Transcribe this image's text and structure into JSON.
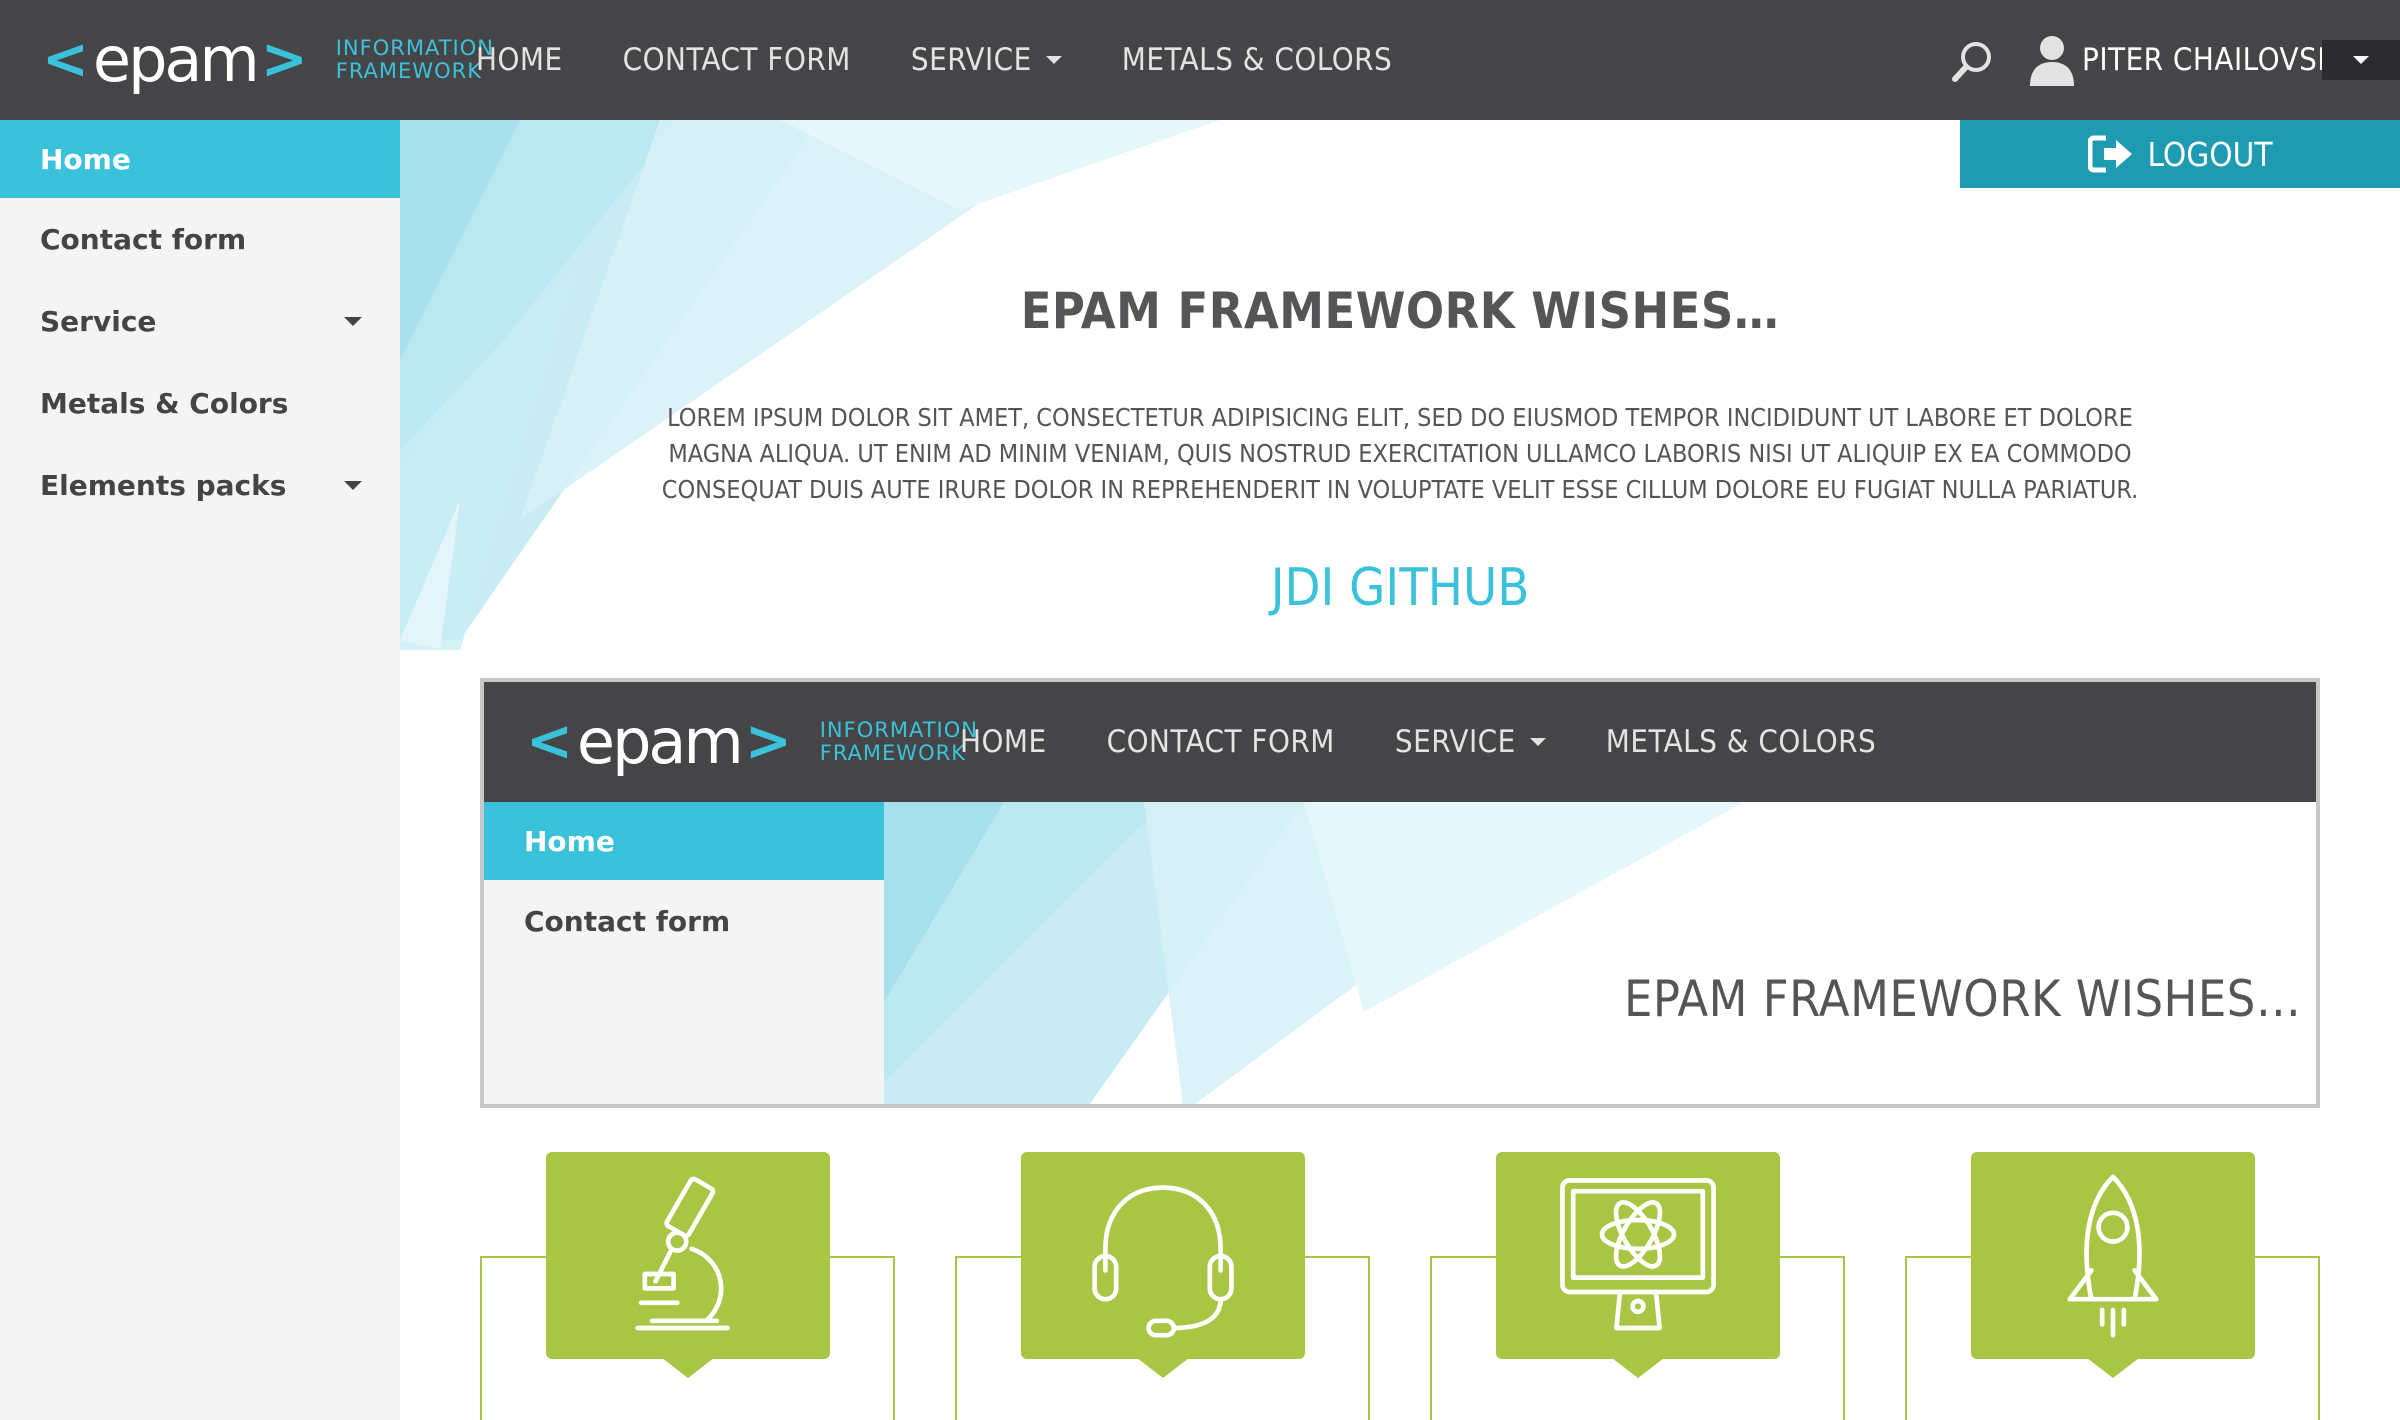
{
  "header": {
    "logo_word": "epam",
    "logo_tag_line1": "INFORMATION",
    "logo_tag_line2": "FRAMEWORK",
    "nav": [
      {
        "label": "HOME"
      },
      {
        "label": "CONTACT FORM"
      },
      {
        "label": "SERVICE",
        "has_dropdown": true
      },
      {
        "label": "METALS & COLORS"
      }
    ],
    "search_icon": "search-icon",
    "user_name": "PITER CHAILOVSKII"
  },
  "sidebar": {
    "items": [
      {
        "label": "Home",
        "active": true
      },
      {
        "label": "Contact form"
      },
      {
        "label": "Service",
        "has_dropdown": true
      },
      {
        "label": "Metals & Colors"
      },
      {
        "label": "Elements packs",
        "has_dropdown": true
      }
    ]
  },
  "main": {
    "logout_label": "LOGOUT",
    "title": "EPAM FRAMEWORK WISHES…",
    "text": "LOREM IPSUM DOLOR SIT AMET, CONSECTETUR ADIPISICING ELIT, SED DO EIUSMOD TEMPOR INCIDIDUNT UT LABORE ET DOLORE MAGNA ALIQUA. UT ENIM AD MINIM VENIAM, QUIS NOSTRUD EXERCITATION ULLAMCO LABORIS NISI UT ALIQUIP EX EA COMMODO CONSEQUAT DUIS AUTE IRURE DOLOR IN REPREHENDERIT IN VOLUPTATE VELIT ESSE CILLUM DOLORE EU FUGIAT NULLA PARIATUR.",
    "link": "JDI GITHUB"
  },
  "frame": {
    "logo_word": "epam",
    "logo_tag_line1": "INFORMATION",
    "logo_tag_line2": "FRAMEWORK",
    "nav": [
      {
        "label": "HOME"
      },
      {
        "label": "CONTACT FORM"
      },
      {
        "label": "SERVICE"
      },
      {
        "label": "METALS & COLORS"
      }
    ],
    "sidebar": [
      {
        "label": "Home",
        "active": true
      },
      {
        "label": "Contact form"
      }
    ],
    "cut_title": "EPAM FRAMEWORK WISHES…"
  },
  "cards": [
    {
      "icon": "microscope-icon"
    },
    {
      "icon": "headset-icon"
    },
    {
      "icon": "monitor-atom-icon"
    },
    {
      "icon": "rocket-icon"
    }
  ],
  "colors": {
    "header_bg": "#454548",
    "accent": "#3bc2db",
    "logout_bg": "#1e9bb1",
    "sidebar_bg": "#f4f4f5",
    "card_green": "#a8c644"
  }
}
